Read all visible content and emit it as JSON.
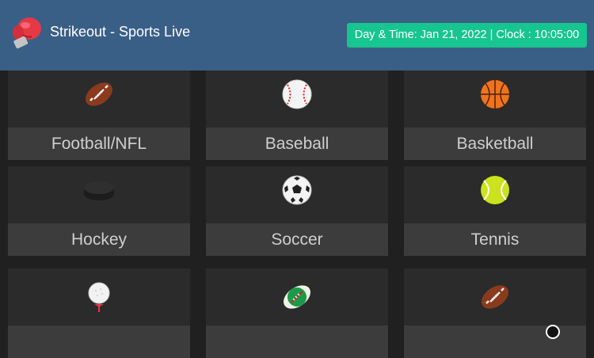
{
  "header": {
    "app_title": "Strikeout - Sports Live",
    "clock_text": "Day & Time: Jan 21, 2022 | Clock : 10:05:00",
    "logo_icon": "boxing-glove-icon"
  },
  "colors": {
    "header_bg": "#3a5f87",
    "clock_bg": "#17c58f",
    "card_bg": "#2b2b2b",
    "label_bg": "#3c3c3c"
  },
  "sports": [
    {
      "label": "Football/NFL",
      "icon": "american-football-icon"
    },
    {
      "label": "Baseball",
      "icon": "baseball-icon"
    },
    {
      "label": "Basketball",
      "icon": "basketball-icon"
    },
    {
      "label": "Hockey",
      "icon": "hockey-puck-icon"
    },
    {
      "label": "Soccer",
      "icon": "soccer-ball-icon"
    },
    {
      "label": "Tennis",
      "icon": "tennis-ball-icon"
    },
    {
      "label": "",
      "icon": "golf-ball-icon"
    },
    {
      "label": "",
      "icon": "rugby-ball-icon"
    },
    {
      "label": "",
      "icon": "american-football-icon"
    }
  ]
}
